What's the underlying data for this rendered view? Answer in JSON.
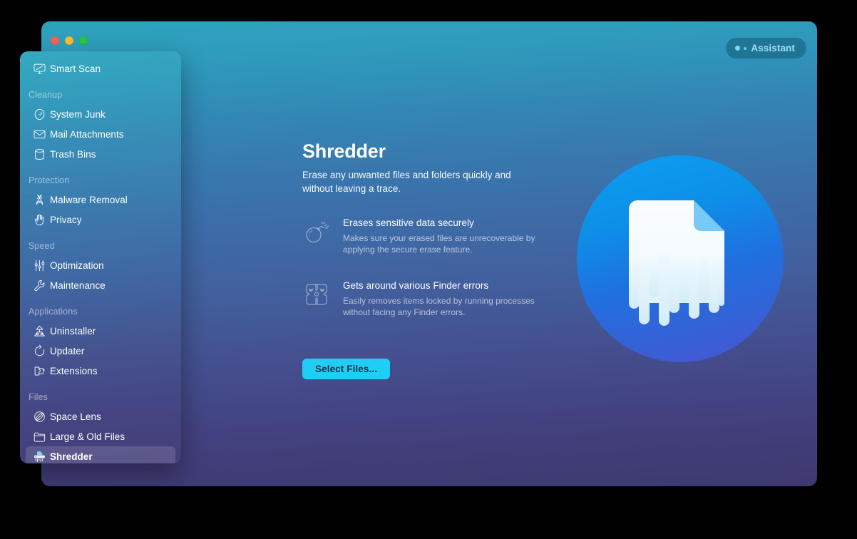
{
  "window": {
    "traffic_lights": [
      "close",
      "minimize",
      "maximize"
    ],
    "assistant_label": "Assistant"
  },
  "colors": {
    "accent_button": "#20cdf5",
    "accent_button_text": "#14304a",
    "assistant_text": "#9fe0f2",
    "window_gradient_top": "#2da2bd",
    "window_gradient_bottom": "#3e3a70",
    "traffic_close": "#ff5f57",
    "traffic_minimize": "#febc2e",
    "traffic_maximize": "#28c840",
    "hero_circle_top": "#0d9aec",
    "hero_circle_bottom": "#3c5ad6"
  },
  "sidebar": {
    "groups": [
      {
        "title": null,
        "items": [
          {
            "label": "Smart Scan",
            "icon": "smart-scan-icon",
            "selected": false
          }
        ]
      },
      {
        "title": "Cleanup",
        "items": [
          {
            "label": "System Junk",
            "icon": "system-junk-icon",
            "selected": false
          },
          {
            "label": "Mail Attachments",
            "icon": "mail-attachments-icon",
            "selected": false
          },
          {
            "label": "Trash Bins",
            "icon": "trash-bins-icon",
            "selected": false
          }
        ]
      },
      {
        "title": "Protection",
        "items": [
          {
            "label": "Malware Removal",
            "icon": "malware-removal-icon",
            "selected": false
          },
          {
            "label": "Privacy",
            "icon": "privacy-icon",
            "selected": false
          }
        ]
      },
      {
        "title": "Speed",
        "items": [
          {
            "label": "Optimization",
            "icon": "optimization-icon",
            "selected": false
          },
          {
            "label": "Maintenance",
            "icon": "maintenance-icon",
            "selected": false
          }
        ]
      },
      {
        "title": "Applications",
        "items": [
          {
            "label": "Uninstaller",
            "icon": "uninstaller-icon",
            "selected": false
          },
          {
            "label": "Updater",
            "icon": "updater-icon",
            "selected": false
          },
          {
            "label": "Extensions",
            "icon": "extensions-icon",
            "selected": false
          }
        ]
      },
      {
        "title": "Files",
        "items": [
          {
            "label": "Space Lens",
            "icon": "space-lens-icon",
            "selected": false
          },
          {
            "label": "Large & Old Files",
            "icon": "large-old-files-icon",
            "selected": false
          },
          {
            "label": "Shredder",
            "icon": "shredder-icon",
            "selected": true
          }
        ]
      }
    ]
  },
  "main": {
    "title": "Shredder",
    "subtitle": "Erase any unwanted files and folders quickly and without leaving a trace.",
    "features": [
      {
        "icon": "bomb-icon",
        "title": "Erases sensitive data securely",
        "description": "Makes sure your erased files are unrecoverable by applying the secure erase feature."
      },
      {
        "icon": "broken-finder-icon",
        "title": "Gets around various Finder errors",
        "description": "Easily removes items locked by running processes without facing any Finder errors."
      }
    ],
    "primary_button": "Select Files...",
    "hero_icon": "shredded-document-icon"
  }
}
